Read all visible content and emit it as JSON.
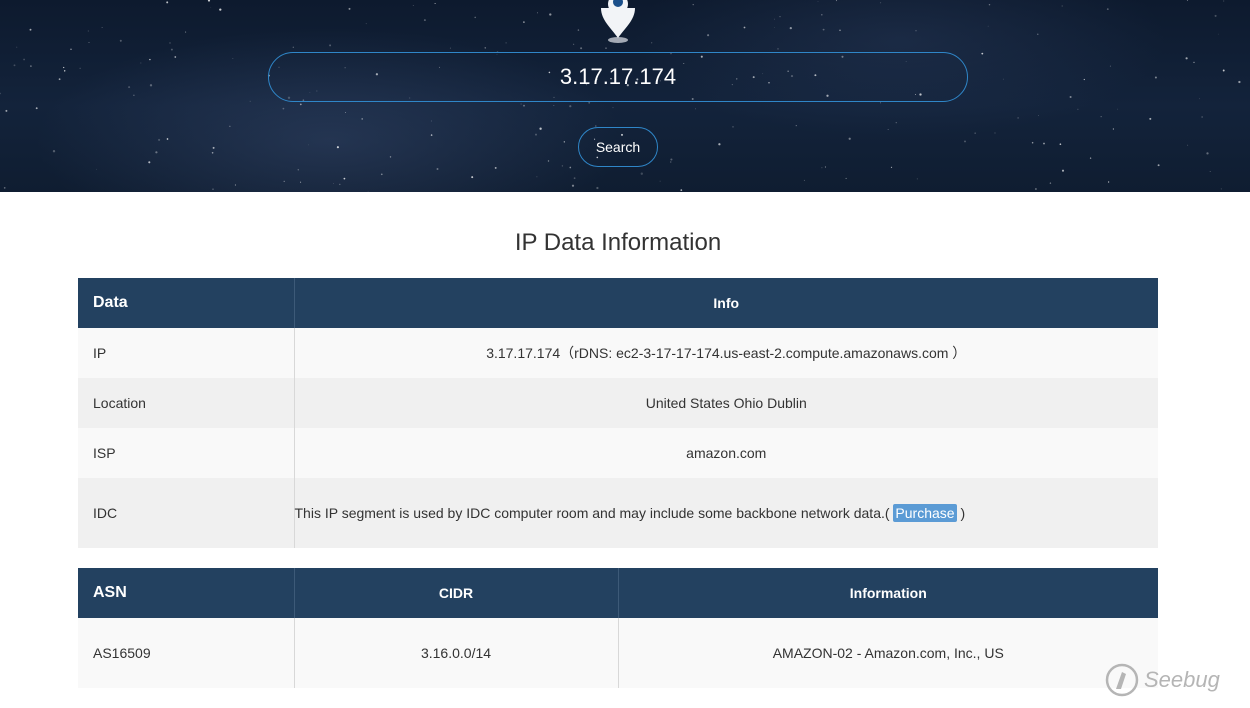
{
  "search": {
    "value": "3.17.17.174",
    "button_label": "Search"
  },
  "icons": {
    "pin": "location-pin-icon",
    "watermark": "seebug-logo-icon"
  },
  "colors": {
    "table_header_bg": "#234160",
    "accent_border": "#2f86c8",
    "highlight": "#5b9bd5"
  },
  "section_title": "IP Data Information",
  "table1": {
    "headers": [
      "Data",
      "Info"
    ],
    "rows": [
      {
        "label": "IP",
        "value": "3.17.17.174（rDNS: ec2-3-17-17-174.us-east-2.compute.amazonaws.com ）"
      },
      {
        "label": "Location",
        "value": "United States Ohio Dublin"
      },
      {
        "label": "ISP",
        "value": "amazon.com"
      },
      {
        "label": "IDC",
        "value_prefix": "This IP segment is used by IDC computer room and may include some backbone network data.( ",
        "link": "Purchase",
        "value_suffix": " )"
      }
    ]
  },
  "table2": {
    "headers": [
      "ASN",
      "CIDR",
      "Information"
    ],
    "rows": [
      {
        "asn": "AS16509",
        "cidr": "3.16.0.0/14",
        "info": "AMAZON-02 - Amazon.com, Inc., US"
      }
    ]
  },
  "watermark": "Seebug"
}
